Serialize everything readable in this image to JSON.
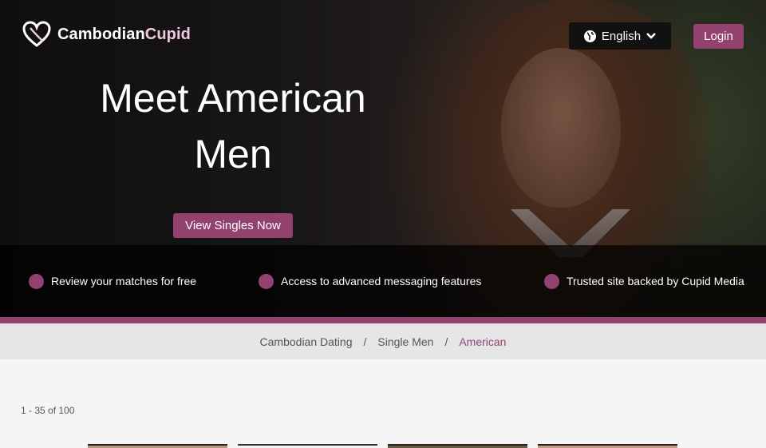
{
  "brand": {
    "name_part1": "Cambodian",
    "name_part2": "Cupid"
  },
  "header": {
    "language_label": "English",
    "login_label": "Login"
  },
  "hero": {
    "headline_line1": "Meet American",
    "headline_line2": "Men",
    "cta_label": "View Singles Now"
  },
  "features": [
    {
      "label": "Review your matches for free"
    },
    {
      "label": "Access to advanced messaging features"
    },
    {
      "label": "Trusted site backed by Cupid Media"
    }
  ],
  "breadcrumb": {
    "items": [
      {
        "label": "Cambodian Dating"
      },
      {
        "label": "Single Men"
      },
      {
        "label": "American"
      }
    ],
    "separator": "/"
  },
  "results": {
    "count_text": "1 - 35 of 100"
  },
  "colors": {
    "accent": "#93426f",
    "band": "#000000",
    "breadcrumb_bg": "#e6e6e6"
  },
  "icons": {
    "logo": "heart-logo-icon",
    "language": "globe-icon",
    "dropdown": "chevron-down-icon",
    "bullet": "dot-icon"
  }
}
